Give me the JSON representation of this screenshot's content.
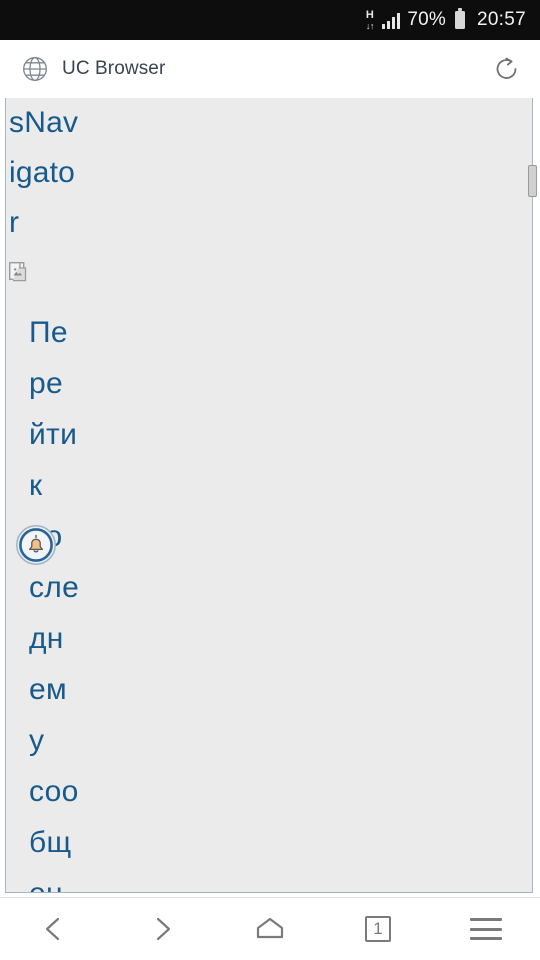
{
  "status_bar": {
    "network_type": "H",
    "network_arrows": "↓↑",
    "signal_icon": "signal-bars-icon",
    "battery_percent": "70%",
    "battery_icon": "battery-icon",
    "clock": "20:57",
    "background": "#0d0d0d",
    "text_color": "#f2f2f2"
  },
  "top_bar": {
    "globe_icon": "globe-icon",
    "title": "UC Browser",
    "refresh_icon": "refresh-icon",
    "title_color": "#3c4250"
  },
  "page_content": {
    "background": "#ebebeb",
    "link_color": "#175a8b",
    "border_color": "#a9b6c2",
    "heading_fragments": [
      "sNav",
      "igato",
      "r"
    ],
    "heading_full_text": "sNavigator",
    "broken_image_icon": "broken-image-icon",
    "bell_badge_icon": "bell-notification-icon",
    "link_fragments": [
      "Пе",
      "ре",
      "йти",
      "к",
      "по",
      "сле",
      "дн",
      "ем",
      "у",
      "соо",
      "бщ",
      "ен"
    ],
    "link_full_text": "Перейти к последнему сообщен"
  },
  "scrollbar": {
    "thumb": "vertical-scrollbar-thumb"
  },
  "bottom_bar": {
    "back_icon": "chevron-left-icon",
    "forward_icon": "chevron-right-icon",
    "home_icon": "home-icon",
    "tabs_count": "1",
    "menu_icon": "hamburger-menu-icon",
    "icon_color": "#7a7a7a"
  }
}
